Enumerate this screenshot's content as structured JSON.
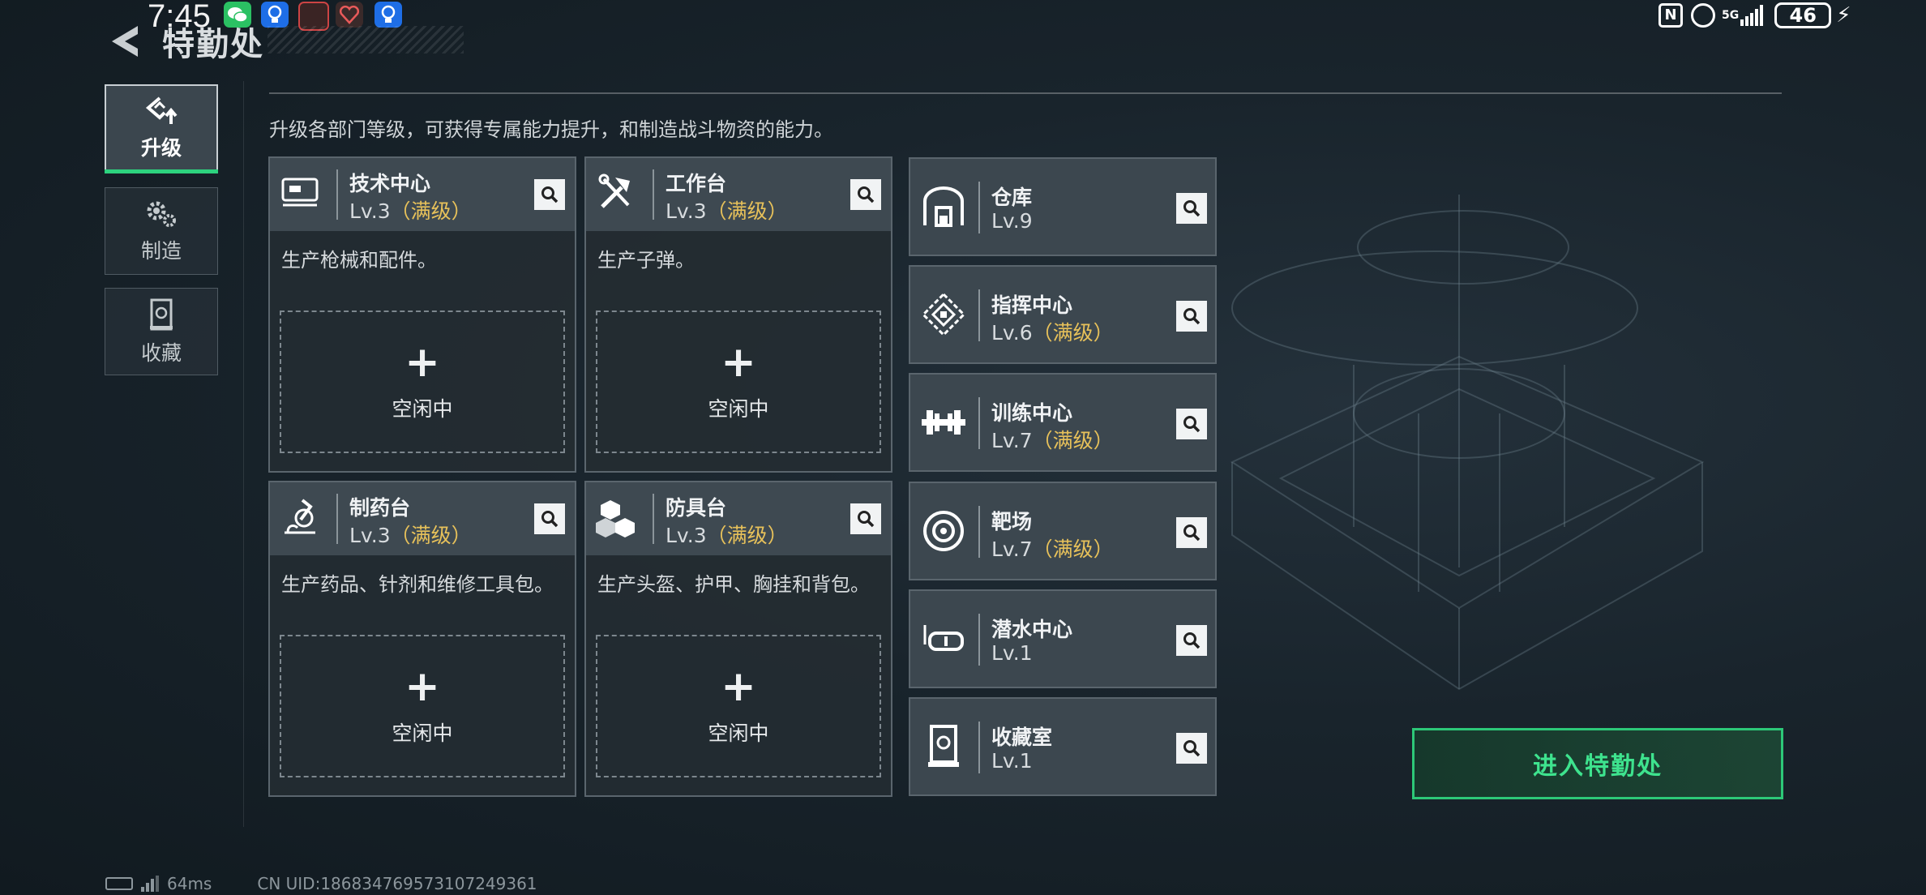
{
  "status_bar": {
    "time": "7:45",
    "battery_level": "46",
    "network": "5G"
  },
  "header": {
    "title": "特勤处"
  },
  "sidebar": {
    "tabs": [
      {
        "label": "升级",
        "active": true,
        "icon": "upgrade-icon"
      },
      {
        "label": "制造",
        "active": false,
        "icon": "gears-icon"
      },
      {
        "label": "收藏",
        "active": false,
        "icon": "collection-icon"
      }
    ]
  },
  "main": {
    "subtitle": "升级各部门等级，可获得专属能力提升，和制造战斗物资的能力。",
    "workstations": [
      {
        "name": "技术中心",
        "level": "Lv.3",
        "max_tag": "（满级）",
        "description": "生产枪械和配件。",
        "slot_status": "空闲中",
        "icon": "tech-center-icon"
      },
      {
        "name": "工作台",
        "level": "Lv.3",
        "max_tag": "（满级）",
        "description": "生产子弹。",
        "slot_status": "空闲中",
        "icon": "workbench-icon"
      },
      {
        "name": "制药台",
        "level": "Lv.3",
        "max_tag": "（满级）",
        "description": "生产药品、针剂和维修工具包。",
        "slot_status": "空闲中",
        "icon": "pharmacy-icon"
      },
      {
        "name": "防具台",
        "level": "Lv.3",
        "max_tag": "（满级）",
        "description": "生产头盔、护甲、胸挂和背包。",
        "slot_status": "空闲中",
        "icon": "armor-bench-icon"
      }
    ],
    "facilities": [
      {
        "name": "仓库",
        "level": "Lv.9",
        "max_tag": "",
        "icon": "warehouse-icon"
      },
      {
        "name": "指挥中心",
        "level": "Lv.6",
        "max_tag": "（满级）",
        "icon": "command-center-icon"
      },
      {
        "name": "训练中心",
        "level": "Lv.7",
        "max_tag": "（满级）",
        "icon": "training-center-icon"
      },
      {
        "name": "靶场",
        "level": "Lv.7",
        "max_tag": "（满级）",
        "icon": "shooting-range-icon"
      },
      {
        "name": "潜水中心",
        "level": "Lv.1",
        "max_tag": "",
        "icon": "diving-center-icon"
      },
      {
        "name": "收藏室",
        "level": "Lv.1",
        "max_tag": "",
        "icon": "collection-room-icon"
      }
    ],
    "enter_button": "进入特勤处"
  },
  "footer": {
    "ping": "64ms",
    "uid": "CN UID:18683476957310724936​1"
  },
  "colors": {
    "accent_green": "#2dd27e",
    "max_level_gold": "#e7c15a",
    "card_header": "#3e4951"
  }
}
